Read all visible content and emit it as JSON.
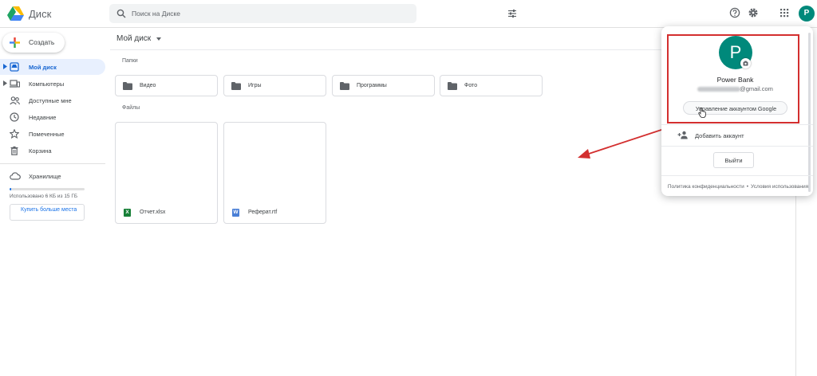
{
  "app": {
    "name": "Диск",
    "brand_colors": [
      "#4285f4",
      "#34a853",
      "#fbbc04",
      "#ea4335"
    ]
  },
  "search": {
    "placeholder": "Поиск на Диске",
    "value": ""
  },
  "header": {
    "icons": [
      "help-icon",
      "gear-icon",
      "apps-grid-icon"
    ],
    "avatar_letter": "P",
    "avatar_color": "#00897b"
  },
  "sidebar": {
    "create_label": "Создать",
    "items": [
      {
        "label": "Мой диск",
        "icon": "my-drive-icon",
        "active": true,
        "expandable": true
      },
      {
        "label": "Компьютеры",
        "icon": "computers-icon",
        "active": false,
        "expandable": true
      },
      {
        "label": "Доступные мне",
        "icon": "shared-with-me-icon",
        "active": false,
        "expandable": false
      },
      {
        "label": "Недавние",
        "icon": "clock-icon",
        "active": false,
        "expandable": false
      },
      {
        "label": "Помеченные",
        "icon": "star-icon",
        "active": false,
        "expandable": false
      },
      {
        "label": "Корзина",
        "icon": "trash-icon",
        "active": false,
        "expandable": false
      }
    ],
    "storage": {
      "label": "Хранилище",
      "used_text": "Использовано 6 КБ из 15 ГБ",
      "used_fraction": 4e-07,
      "buy_label": "Купить больше места"
    }
  },
  "main": {
    "breadcrumb": "Мой диск",
    "folders_label": "Папки",
    "folders": [
      "Видео",
      "Игры",
      "Программы",
      "Фото"
    ],
    "files_label": "Файлы",
    "files": [
      {
        "name": "Отчет.xlsx",
        "type_letter": "X",
        "type_color": "#188038"
      },
      {
        "name": "Реферат.rtf",
        "type_letter": "W",
        "type_color": "#4a7fd6"
      }
    ]
  },
  "account_popup": {
    "avatar_letter": "P",
    "name": "Power Bank",
    "email_visible": "@gmail.com",
    "manage_label": "Управление аккаунтом Google",
    "add_account_label": "Добавить аккаунт",
    "signout_label": "Выйти",
    "privacy_link": "Политика конфиденциальности",
    "terms_link": "Условия использования"
  },
  "annotation": {
    "color": "#d32f2f"
  }
}
